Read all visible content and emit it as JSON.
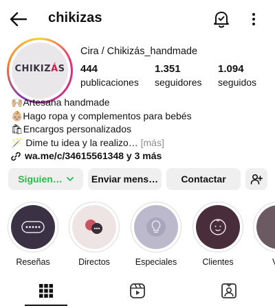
{
  "header": {
    "username": "chikizas"
  },
  "profile": {
    "display_name": "Cira / Chikizás_handmade",
    "avatar_logo": {
      "prefix": "CHIKIZ",
      "highlight": "Á",
      "suffix": "S"
    },
    "stats": [
      {
        "value": "444",
        "label": "publicaciones"
      },
      {
        "value": "1.351",
        "label": "seguidores"
      },
      {
        "value": "1.094",
        "label": "seguidos"
      }
    ]
  },
  "bio": {
    "lines": [
      "🙌🏼Artesana handmade",
      "👶🏼Hago ropa y complementos para bebés",
      "🛍Encargos personalizados",
      "🪄 Dime tu idea y la realizo…"
    ],
    "more": "[más]",
    "link": "wa.me/c/34615561348 y 3 más"
  },
  "actions": {
    "follow": "Siguien…",
    "message": "Enviar mens…",
    "contact": "Contactar"
  },
  "highlights": [
    {
      "label": "Reseñas",
      "color": "#3b3145"
    },
    {
      "label": "Directos",
      "color": "#efe4e4"
    },
    {
      "label": "Especiales",
      "color": "#bdb9cd"
    },
    {
      "label": "Clientes",
      "color": "#4a2d3a"
    },
    {
      "label": "V",
      "color": "#6b5a62"
    }
  ],
  "colors": {
    "follow_text": "#2db84d",
    "button_bg": "#efefef",
    "avatar_accent": "#c2234c"
  }
}
